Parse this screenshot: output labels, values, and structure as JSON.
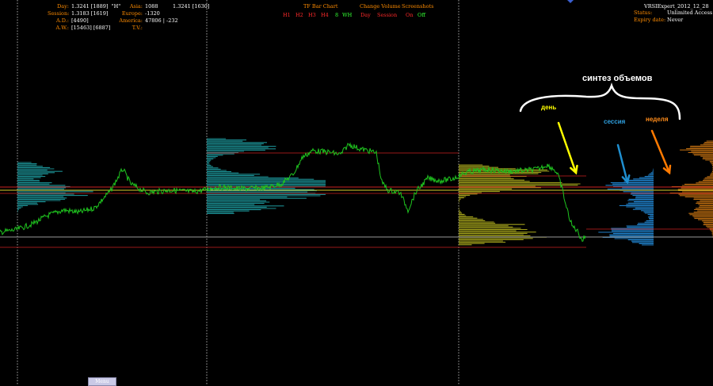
{
  "info_left": {
    "day_label": "Day:",
    "day_value": "1.3241 [1889]",
    "day_flag": "\"H\"",
    "session_label": "Session:",
    "session_value": "1.3183 [1619]",
    "ad_label": "A.D.:",
    "ad_value": "[4490]",
    "aw_label": "A.W.:",
    "aw_value": "[15463] [6887]"
  },
  "info_mid": {
    "asia_label": "Asia:",
    "asia_value": "1088",
    "asia_extra": "1.3241 [1630]",
    "europe_label": "Europe:",
    "europe_value": "-1320",
    "america_label": "America:",
    "america_value": "",
    "tv_label": "T.V.:",
    "tv_value": "47806 | -232"
  },
  "toolbar": {
    "tf_title": "TF Bar Chart",
    "tf_options": [
      {
        "label": "H1",
        "state": "off"
      },
      {
        "label": "H2",
        "state": "off"
      },
      {
        "label": "H3",
        "state": "off"
      },
      {
        "label": "H4",
        "state": "off"
      },
      {
        "label": "8",
        "state": "on"
      },
      {
        "label": "WH",
        "state": "on"
      }
    ],
    "cv_title": "Change Volume",
    "cv_options": [
      {
        "label": "Day",
        "state": "off"
      },
      {
        "label": "Session",
        "state": "off"
      }
    ],
    "ss_title": "Screenshots",
    "ss_options": [
      {
        "label": "On",
        "state": "off"
      },
      {
        "label": "Off",
        "state": "on"
      }
    ]
  },
  "status_panel": {
    "product": "VRSIExpert_2012_12_28",
    "status_label": "Status:",
    "status_value": "Unlimited Access",
    "expiry_label": "Expiry date:",
    "expiry_value": "Never"
  },
  "annotations": {
    "title": "синтез объемов",
    "day": "день",
    "session": "сессия",
    "week": "неделя"
  },
  "menu_label": "Menu",
  "colors": {
    "price": "#1fc41f",
    "cyan_profile": "#1a8a8e",
    "olive_profile": "#9c9a1a",
    "blue_profile": "#1f7fc8",
    "orange_profile": "#b86a10",
    "red_level": "#cc2222",
    "yellow_level": "#d8cc2a",
    "grey_level": "#999999",
    "arrow_day": "#ffff00",
    "arrow_session": "#1f8fd0",
    "arrow_week": "#ff7a00"
  }
}
